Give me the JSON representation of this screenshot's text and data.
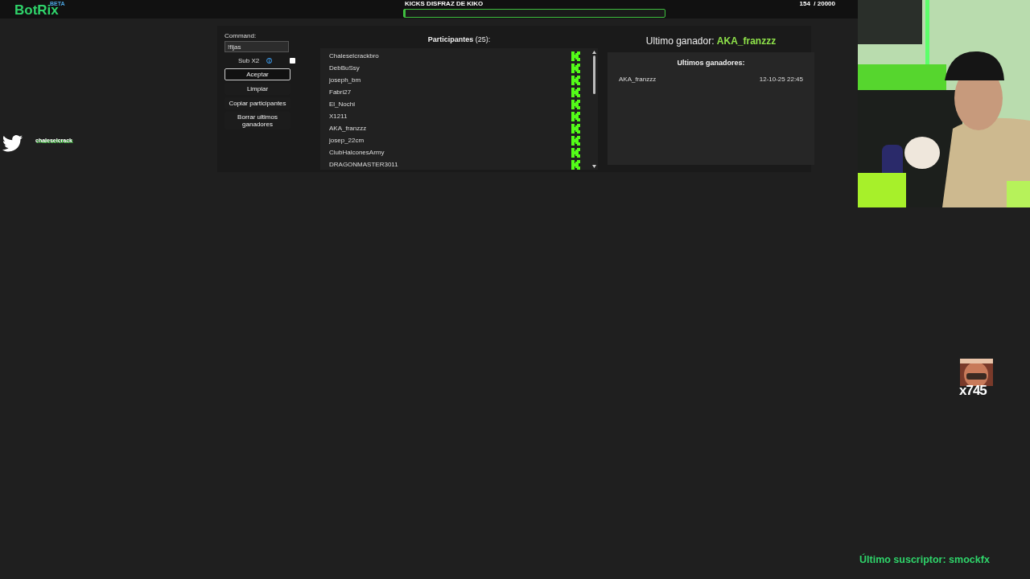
{
  "logo": {
    "name": "BotRix",
    "badge": "BETA"
  },
  "goal": {
    "title": "KICKS DISFRAZ DE KIKO",
    "count": "154  / 20000",
    "level": 0.0077
  },
  "controls": {
    "command_label": "Command:",
    "command_value": "!fijas",
    "sub_label": "Sub X2",
    "sub_checked": false,
    "buttons": [
      {
        "label": "Aceptar",
        "kind": "outlined"
      },
      {
        "label": "Limpiar",
        "kind": "plain"
      },
      {
        "label": "Copiar participantes",
        "kind": "plain"
      },
      {
        "label": "Borrar ultimos ganadores",
        "kind": "plain"
      }
    ]
  },
  "participants": {
    "title": "Participantes",
    "count": "(25):",
    "items": [
      "Chaleselcrackbro",
      "DebBuSsy",
      "joseph_bm",
      "Fabri27",
      "El_Nochi",
      "X1211",
      "AKA_franzzz",
      "josep_22cm",
      "ClubHalconesArmy",
      "DRAGONMASTER3011"
    ]
  },
  "winner": {
    "label": "Ultimo ganador:",
    "name": "AKA_franzzz",
    "history_title": "Ultimos ganadores:",
    "history": [
      {
        "name": "AKA_franzzz",
        "time": "12-10-25 22:45"
      }
    ]
  },
  "social": {
    "handle": "chaleselcrack"
  },
  "emote": {
    "count": "x745"
  },
  "last_sub": "Último suscriptor: smockfx"
}
